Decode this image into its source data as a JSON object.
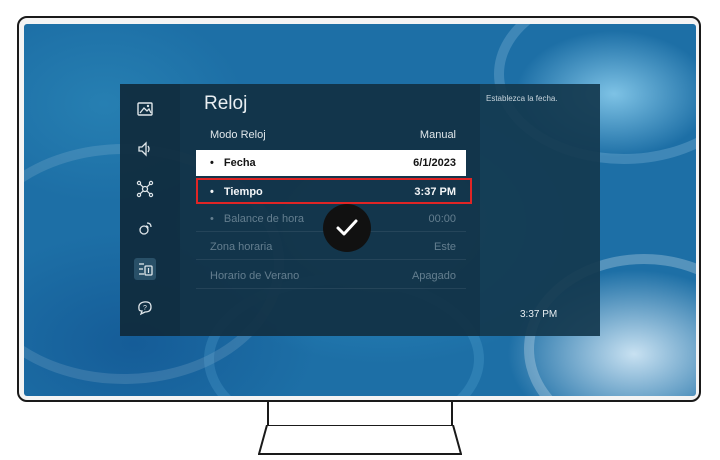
{
  "menu": {
    "title": "Reloj",
    "rows": [
      {
        "label": "Modo Reloj",
        "value": "Manual",
        "bullet": ""
      },
      {
        "label": "Fecha",
        "value": "6/1/2023",
        "bullet": "•"
      },
      {
        "label": "Tiempo",
        "value": "3:37 PM",
        "bullet": "•"
      },
      {
        "label": "Balance de hora",
        "value": "00:00",
        "bullet": "•"
      },
      {
        "label": "Zona horaria",
        "value": "Este",
        "bullet": ""
      },
      {
        "label": "Horario de Verano",
        "value": "Apagado",
        "bullet": ""
      }
    ]
  },
  "sidebar": {
    "icons": [
      "picture-icon",
      "sound-icon",
      "connection-icon",
      "broadcasting-icon",
      "general-icon",
      "support-icon"
    ]
  },
  "info": {
    "description": "Establezca la fecha.",
    "time": "3:37 PM"
  },
  "colors": {
    "highlight_border": "#e02525",
    "selected_row": "#ffffff",
    "panel": "#123246"
  }
}
